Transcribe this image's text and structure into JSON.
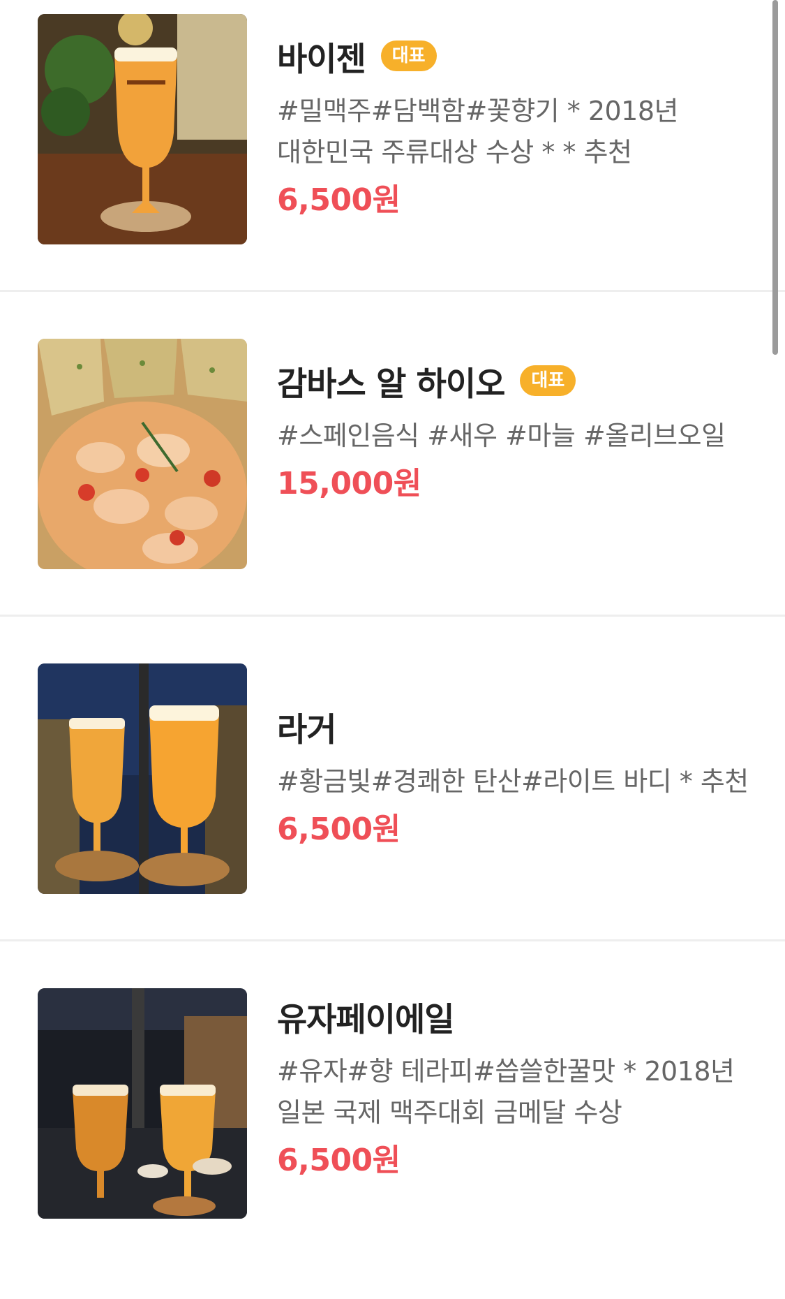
{
  "menu": {
    "items": [
      {
        "name": "바이젠",
        "badge": "대표",
        "description": "#밀맥주#담백함#꽃향기 * 2018년 대한민국 주류대상 수상 * * 추천",
        "price": "6,500원",
        "image_icon": "wheat-beer-photo"
      },
      {
        "name": "감바스 알 하이오",
        "badge": "대표",
        "description": "#스페인음식 #새우 #마늘 #올리브오일",
        "price": "15,000원",
        "image_icon": "gambas-photo"
      },
      {
        "name": "라거",
        "badge": "",
        "description": "#황금빛#경쾌한 탄산#라이트 바디 * 추천",
        "price": "6,500원",
        "image_icon": "lager-photo"
      },
      {
        "name": "유자페이에일",
        "badge": "",
        "description": "#유자#향 테라피#씁쓸한꿀맛 * 2018년 일본 국제 맥주대회 금메달 수상",
        "price": "6,500원",
        "image_icon": "yuzu-pale-ale-photo"
      }
    ]
  },
  "colors": {
    "badge": "#f7b02a",
    "price": "#ef4f57",
    "title": "#222222",
    "description": "#666666",
    "divider": "#eeeeee"
  }
}
